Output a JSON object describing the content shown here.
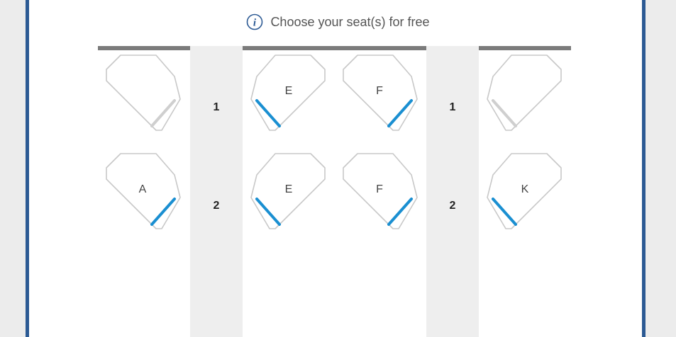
{
  "header": {
    "text": "Choose your seat(s) for free",
    "icon": "info-icon"
  },
  "colors": {
    "frame": "#2c5a94",
    "accent": "#1a8fd1",
    "seat_outline": "#c8c8c8",
    "unavailable": "#cfcfcf",
    "aisle": "#eeeeee"
  },
  "rows": [
    {
      "number": "1",
      "seats": [
        {
          "letter": "",
          "status": "unavailable"
        },
        {
          "letter": "E",
          "status": "available"
        },
        {
          "letter": "F",
          "status": "available"
        },
        {
          "letter": "",
          "status": "unavailable"
        }
      ]
    },
    {
      "number": "2",
      "seats": [
        {
          "letter": "A",
          "status": "available"
        },
        {
          "letter": "E",
          "status": "available"
        },
        {
          "letter": "F",
          "status": "available"
        },
        {
          "letter": "K",
          "status": "available"
        }
      ]
    }
  ]
}
